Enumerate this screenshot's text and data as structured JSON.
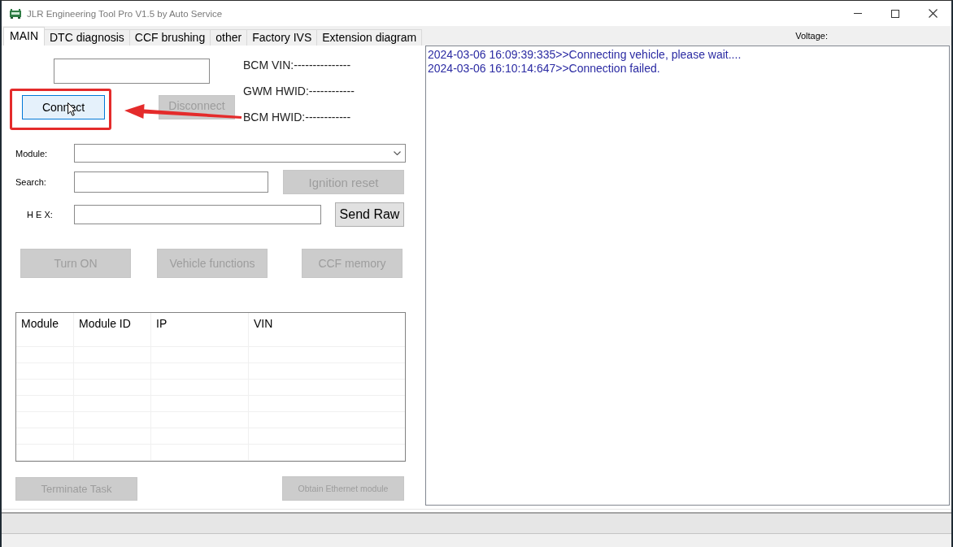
{
  "window": {
    "title": "JLR Engineering Tool Pro V1.5 by Auto Service"
  },
  "tabs": [
    {
      "label": "MAIN",
      "selected": true
    },
    {
      "label": "DTC diagnosis",
      "selected": false
    },
    {
      "label": "CCF brushing",
      "selected": false
    },
    {
      "label": "other",
      "selected": false
    },
    {
      "label": "Factory IVS",
      "selected": false
    },
    {
      "label": "Extension diagram",
      "selected": false
    }
  ],
  "voltage": {
    "label": "Voltage:"
  },
  "vehicle_info": [
    "BCM VIN:---------------",
    "GWM HWID:------------",
    "BCM HWID:------------"
  ],
  "connection_buttons": [
    {
      "label": "Connect",
      "disabled": false,
      "hovered": true
    },
    {
      "label": "Disconnect",
      "disabled": true,
      "hovered": false
    }
  ],
  "form_rows": [
    {
      "label": "Module:",
      "kind": "combo"
    },
    {
      "label": "Search:",
      "kind": "text",
      "button": {
        "label": "Ignition reset",
        "disabled": true
      }
    },
    {
      "label": "H E X:",
      "kind": "text",
      "button": {
        "label": "Send Raw",
        "disabled": false
      }
    }
  ],
  "action_buttons": [
    {
      "label": "Turn ON",
      "disabled": true
    },
    {
      "label": "Vehicle functions",
      "disabled": true
    },
    {
      "label": "CCF memory",
      "disabled": true
    }
  ],
  "module_table": {
    "columns": [
      "Module",
      "Module ID",
      "IP",
      "VIN"
    ]
  },
  "footer_buttons": [
    {
      "label": "Terminate Task",
      "disabled": true
    },
    {
      "label": "Obtain Ethernet module",
      "disabled": true
    }
  ],
  "log": {
    "lines": [
      "2024-03-06 16:09:39:335>>Connecting vehicle, please wait....",
      "2024-03-06 16:10:14:647>>Connection failed."
    ]
  }
}
